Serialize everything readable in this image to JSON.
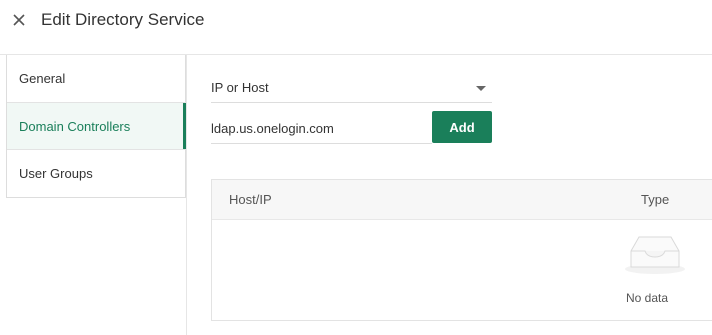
{
  "header": {
    "title": "Edit Directory Service",
    "close_icon": "close-icon"
  },
  "sidebar": {
    "items": [
      {
        "label": "General",
        "active": false
      },
      {
        "label": "Domain Controllers",
        "active": true
      },
      {
        "label": "User Groups",
        "active": false
      }
    ]
  },
  "form": {
    "select": {
      "value": "IP or Host",
      "icon": "chevron-down-icon"
    },
    "host_input": {
      "value": "ldap.us.onelogin.com",
      "placeholder": ""
    },
    "add_label": "Add"
  },
  "table": {
    "columns": [
      "Host/IP",
      "Type"
    ],
    "rows": [],
    "empty_text": "No data",
    "empty_icon": "empty-inbox-icon"
  },
  "colors": {
    "accent": "#1a7f5a",
    "active_bg": "#f1f8f5"
  }
}
